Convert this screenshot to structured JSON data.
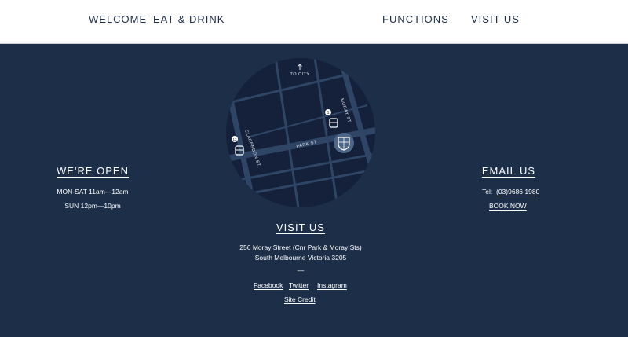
{
  "nav": {
    "welcome": "WELCOME",
    "eat_drink": "EAT & DRINK",
    "functions": "FUNCTIONS",
    "visit_us": "VISIT US"
  },
  "open": {
    "title": "WE'RE OPEN",
    "line1": "MON-SAT 11am—12am",
    "line2": "SUN 12pm—10pm"
  },
  "email": {
    "title": "EMAIL US",
    "tel_label": "Tel:",
    "tel_number": "(03)9686 1980",
    "book_now": "BOOK NOW"
  },
  "visit": {
    "title": "VISIT US",
    "address_line1": "256 Moray Street (Cnr Park & Moray Sts)",
    "address_line2": "South Melbourne Victoria 3205",
    "divider": "—",
    "facebook": "Facebook",
    "twitter": "Twitter",
    "instagram": "Instagram",
    "site_credit": "Site Credit"
  },
  "map": {
    "to_city": "TO CITY",
    "street_moray": "MORAY ST",
    "street_clarendon": "CLARENDON ST",
    "street_park": "PARK ST",
    "stop_1": "1",
    "stop_12": "12"
  },
  "colors": {
    "background": "#1c2e48",
    "map_fill": "#15213a",
    "road": "#2f4566",
    "topbar": "#ffffff"
  },
  "icons": {
    "arrow": "up-arrow-icon",
    "tram": "tram-icon",
    "venue": "crest-icon"
  }
}
